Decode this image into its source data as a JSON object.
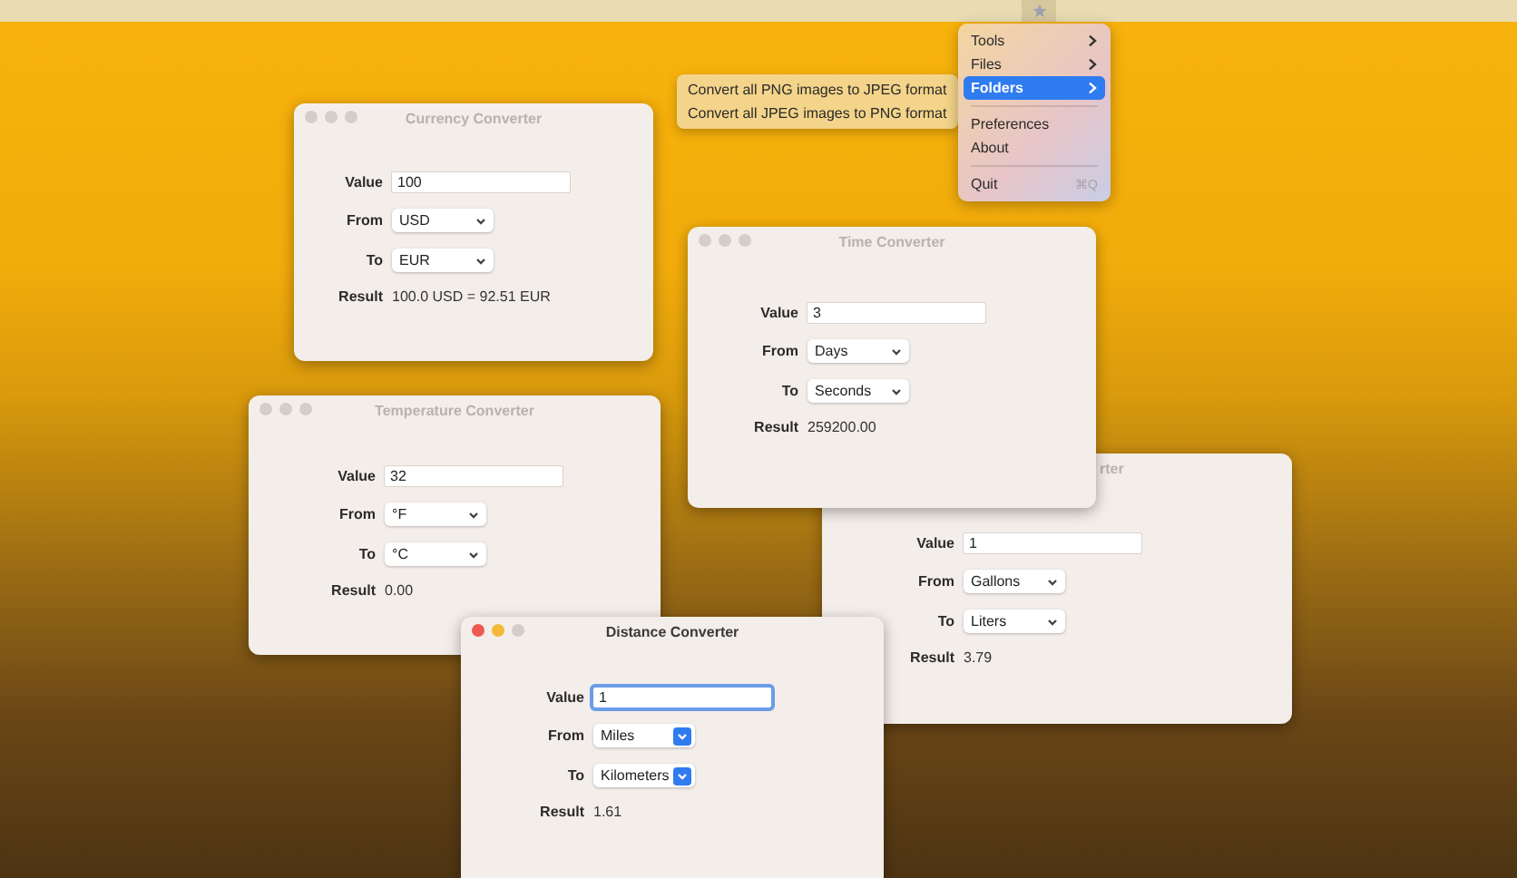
{
  "menu_bar": {
    "status_icon": {
      "selected": true
    }
  },
  "windows": [
    {
      "title": "Currency Converter",
      "active": false,
      "value": "100",
      "from": "USD",
      "to": "EUR",
      "result": "100.0 USD = 92.51 EUR",
      "labels": {
        "value": "Value",
        "from": "From",
        "to": "To",
        "result": "Result"
      }
    },
    {
      "title": "Temperature Converter",
      "active": false,
      "value": "32",
      "from": "°F",
      "to": "°C",
      "result": "0.00",
      "labels": {
        "value": "Value",
        "from": "From",
        "to": "To",
        "result": "Result"
      }
    },
    {
      "title": "rter",
      "active": false,
      "value": "1",
      "from": "Gallons",
      "to": "Liters",
      "result": "3.79",
      "labels": {
        "value": "Value",
        "from": "From",
        "to": "To",
        "result": "Result"
      }
    },
    {
      "title": "Time Converter",
      "active": false,
      "value": "3",
      "from": "Days",
      "to": "Seconds",
      "result": "259200.00",
      "labels": {
        "value": "Value",
        "from": "From",
        "to": "To",
        "result": "Result"
      }
    },
    {
      "title": "Distance Converter",
      "active": true,
      "value": "1",
      "from": "Miles",
      "to": "Kilometers",
      "result": "1.61",
      "labels": {
        "value": "Value",
        "from": "From",
        "to": "To",
        "result": "Result"
      }
    }
  ],
  "menu": {
    "items": [
      {
        "kind": "item",
        "label": "Tools",
        "submenu": true,
        "selected": false
      },
      {
        "kind": "item",
        "label": "Files",
        "submenu": true,
        "selected": false
      },
      {
        "kind": "item",
        "label": "Folders",
        "submenu": true,
        "selected": true
      },
      {
        "kind": "separator"
      },
      {
        "kind": "item",
        "label": "Preferences",
        "submenu": false,
        "selected": false
      },
      {
        "kind": "item",
        "label": "About",
        "submenu": false,
        "selected": false
      },
      {
        "kind": "separator"
      },
      {
        "kind": "item",
        "label": "Quit",
        "submenu": false,
        "selected": false,
        "shortcut": "⌘Q"
      }
    ]
  },
  "submenu": {
    "items": [
      {
        "label": "Convert all PNG images to JPEG format",
        "selected": false
      },
      {
        "label": "Convert all JPEG images to PNG format",
        "selected": false
      }
    ]
  }
}
